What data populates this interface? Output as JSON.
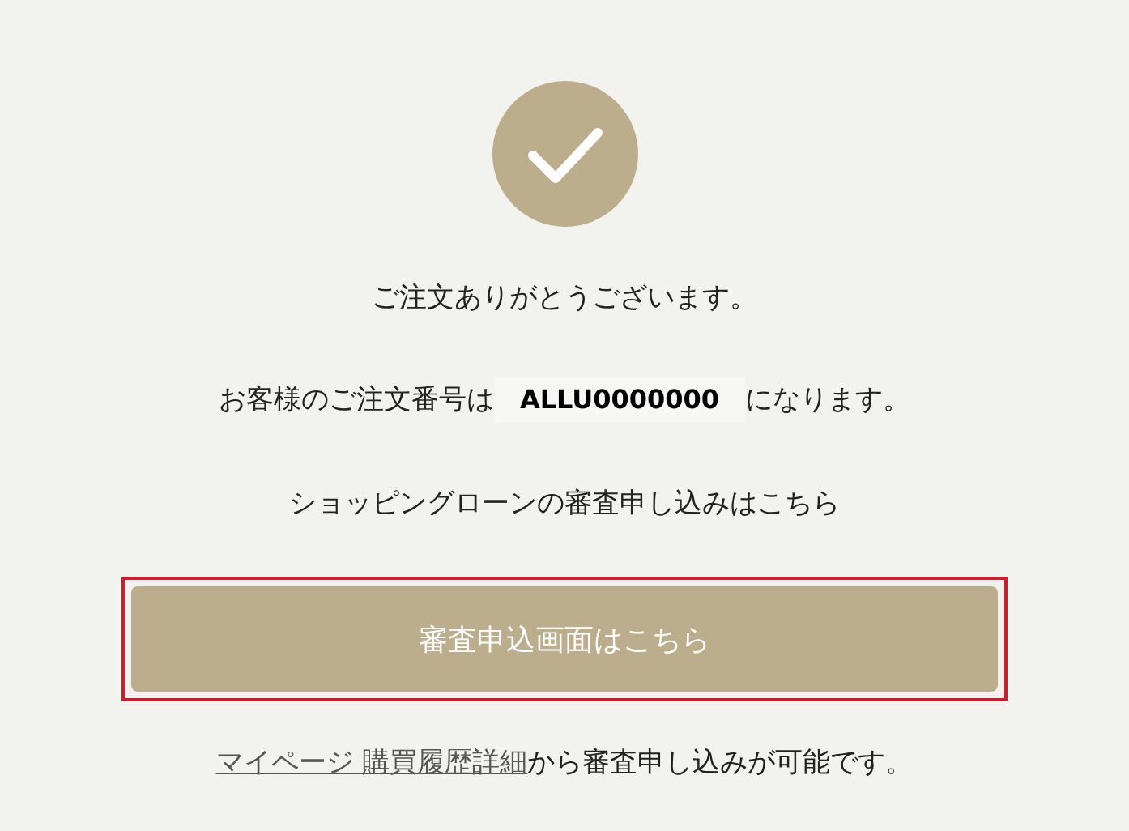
{
  "thanks": "ご注文ありがとうございます。",
  "order": {
    "before": "お客様のご注文番号は",
    "number": "ALLU0000000",
    "after": "になります。"
  },
  "loan_note": "ショッピングローンの審査申し込みはこちら",
  "apply_button": {
    "label": "審査申込画面はこちら",
    "highlighted": true
  },
  "footer": {
    "link": "マイページ 購買履歴詳細",
    "text": "から審査申し込みが可能です。"
  }
}
